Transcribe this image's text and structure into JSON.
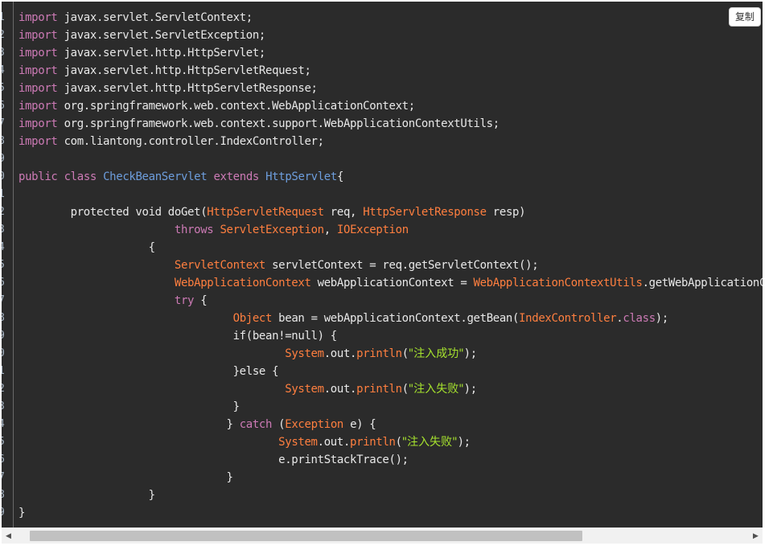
{
  "copy_button": {
    "label": "复制"
  },
  "line_numbers": [
    "1",
    "2",
    "3",
    "4",
    "5",
    "6",
    "7",
    "8",
    "9",
    "0",
    "1",
    "2",
    "3",
    "4",
    "5",
    "6",
    "7",
    "8",
    "9",
    "0",
    "1",
    "2",
    "3",
    "4",
    "5",
    "6",
    "7",
    "8",
    "9"
  ],
  "colors": {
    "background": "#2b2b2b",
    "keyword": "#cc7ab5",
    "type": "#ff7f3f",
    "class_name": "#6d9ddc",
    "string": "#a6e22e",
    "plain": "#e8e8e8"
  },
  "code_lines": [
    [
      [
        "import",
        "kw"
      ],
      [
        " javax.servlet.ServletContext;",
        ""
      ]
    ],
    [
      [
        "import",
        "kw"
      ],
      [
        " javax.servlet.ServletException;",
        ""
      ]
    ],
    [
      [
        "import",
        "kw"
      ],
      [
        " javax.servlet.http.HttpServlet;",
        ""
      ]
    ],
    [
      [
        "import",
        "kw"
      ],
      [
        " javax.servlet.http.HttpServletRequest;",
        ""
      ]
    ],
    [
      [
        "import",
        "kw"
      ],
      [
        " javax.servlet.http.HttpServletResponse;",
        ""
      ]
    ],
    [
      [
        "import",
        "kw"
      ],
      [
        " org.springframework.web.context.WebApplicationContext;",
        ""
      ]
    ],
    [
      [
        "import",
        "kw"
      ],
      [
        " org.springframework.web.context.support.WebApplicationContextUtils;",
        ""
      ]
    ],
    [
      [
        "import",
        "kw"
      ],
      [
        " com.liantong.controller.IndexController;",
        ""
      ]
    ],
    [],
    [
      [
        "public",
        "kw"
      ],
      [
        " ",
        ""
      ],
      [
        "class",
        "kw"
      ],
      [
        " ",
        ""
      ],
      [
        "CheckBeanServlet",
        "cls"
      ],
      [
        " ",
        ""
      ],
      [
        "extends",
        "kw"
      ],
      [
        " ",
        ""
      ],
      [
        "HttpServlet",
        "cls"
      ],
      [
        "{",
        ""
      ]
    ],
    [],
    [
      [
        "        protected void doGet(",
        ""
      ],
      [
        "HttpServletRequest",
        "ty"
      ],
      [
        " req, ",
        ""
      ],
      [
        "HttpServletResponse",
        "ty"
      ],
      [
        " resp)",
        ""
      ]
    ],
    [
      [
        "                        ",
        ""
      ],
      [
        "throws",
        "kw"
      ],
      [
        " ",
        ""
      ],
      [
        "ServletException",
        "ty"
      ],
      [
        ", ",
        ""
      ],
      [
        "IOException",
        "ty"
      ]
    ],
    [
      [
        "                    {",
        ""
      ]
    ],
    [
      [
        "                        ",
        ""
      ],
      [
        "ServletContext",
        "ty"
      ],
      [
        " servletContext = req.getServletContext();",
        ""
      ]
    ],
    [
      [
        "                        ",
        ""
      ],
      [
        "WebApplicationContext",
        "ty"
      ],
      [
        " webApplicationContext = ",
        ""
      ],
      [
        "WebApplicationContextUtils",
        "ty"
      ],
      [
        ".getWebApplicationContext(servletContext);",
        ""
      ]
    ],
    [
      [
        "                        ",
        ""
      ],
      [
        "try",
        "kw"
      ],
      [
        " {",
        ""
      ]
    ],
    [
      [
        "                                 ",
        ""
      ],
      [
        "Object",
        "ty"
      ],
      [
        " bean = webApplicationContext.getBean(",
        ""
      ],
      [
        "IndexController",
        "ty"
      ],
      [
        ".",
        ""
      ],
      [
        "class",
        "kw"
      ],
      [
        ");",
        ""
      ]
    ],
    [
      [
        "                                 if(bean!=null) {",
        ""
      ]
    ],
    [
      [
        "                                         ",
        ""
      ],
      [
        "System",
        "ty"
      ],
      [
        ".out.",
        ""
      ],
      [
        "println",
        "ty"
      ],
      [
        "(",
        ""
      ],
      [
        "\"注入成功\"",
        "str"
      ],
      [
        ");",
        ""
      ]
    ],
    [
      [
        "                                 }else {",
        ""
      ]
    ],
    [
      [
        "                                         ",
        ""
      ],
      [
        "System",
        "ty"
      ],
      [
        ".out.",
        ""
      ],
      [
        "println",
        "ty"
      ],
      [
        "(",
        ""
      ],
      [
        "\"注入失败\"",
        "str"
      ],
      [
        ");",
        ""
      ]
    ],
    [
      [
        "                                 }",
        ""
      ]
    ],
    [
      [
        "                                } ",
        ""
      ],
      [
        "catch",
        "kw"
      ],
      [
        " (",
        ""
      ],
      [
        "Exception",
        "ty"
      ],
      [
        " e) {",
        ""
      ]
    ],
    [
      [
        "                                        ",
        ""
      ],
      [
        "System",
        "ty"
      ],
      [
        ".out.",
        ""
      ],
      [
        "println",
        "ty"
      ],
      [
        "(",
        ""
      ],
      [
        "\"注入失败\"",
        "str"
      ],
      [
        ");",
        ""
      ]
    ],
    [
      [
        "                                        e.printStackTrace();",
        ""
      ]
    ],
    [
      [
        "                                }",
        ""
      ]
    ],
    [
      [
        "                    }",
        ""
      ]
    ],
    [
      [
        "}",
        ""
      ]
    ]
  ],
  "scrollbar": {
    "position_fraction": 0.0,
    "visible_fraction": 0.76
  }
}
